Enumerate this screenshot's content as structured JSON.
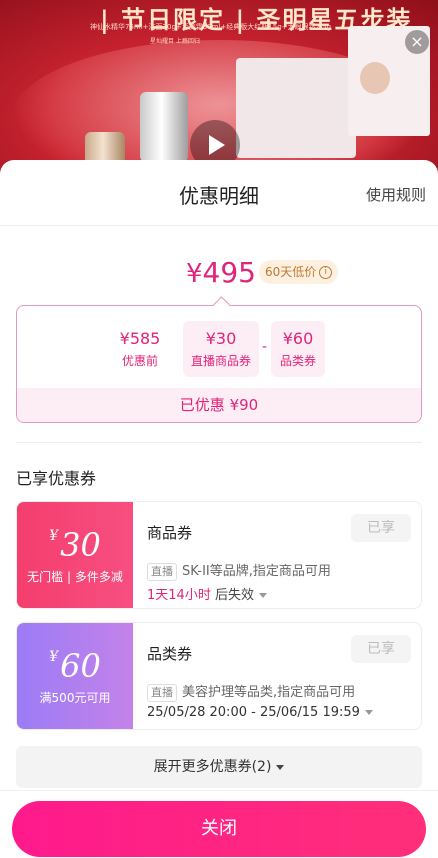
{
  "banner": {
    "title": "| 节日限定 | 圣明星五步装",
    "subtitle": "神仙水精华75ml+洁面20g+至美霜30ml+经典版大红瓶15g+大眼眼霜2.5g",
    "subtitle2": "星灿耀目 上瘾回归",
    "close_icon": "close-icon",
    "play_icon": "play-icon"
  },
  "sheet": {
    "title": "优惠明细",
    "rules_label": "使用规则"
  },
  "price": {
    "currency": "¥",
    "final": "495",
    "low_tag": "60天低价",
    "info_icon": "ⓘ"
  },
  "calc": {
    "items": [
      {
        "value": "¥585",
        "label": "优惠前"
      },
      {
        "value": "¥30",
        "label": "直播商品券"
      },
      {
        "value": "¥60",
        "label": "品类券"
      }
    ],
    "op": "-",
    "saved": "已优惠 ¥90"
  },
  "coupons_section_title": "已享优惠券",
  "coupons": [
    {
      "symbol": "¥",
      "amount": "30",
      "condition": "无门槛 | 多件多减",
      "name": "商品券",
      "button": "已享",
      "tag": "直播",
      "desc": "SK-II等品牌,指定商品可用",
      "time": "1天14小时",
      "time_suffix": " 后失效",
      "color": "#f43e6e"
    },
    {
      "symbol": "¥",
      "amount": "60",
      "condition": "满500元可用",
      "name": "品类券",
      "button": "已享",
      "tag": "直播",
      "desc": "美容护理等品类,指定商品可用",
      "time": "25/05/28 20:00 - 25/06/15 19:59",
      "color": "#9c7cf6"
    }
  ],
  "expand_label": "展开更多优惠券(2)",
  "close_label": "关闭",
  "accent_color": "#e0247a"
}
